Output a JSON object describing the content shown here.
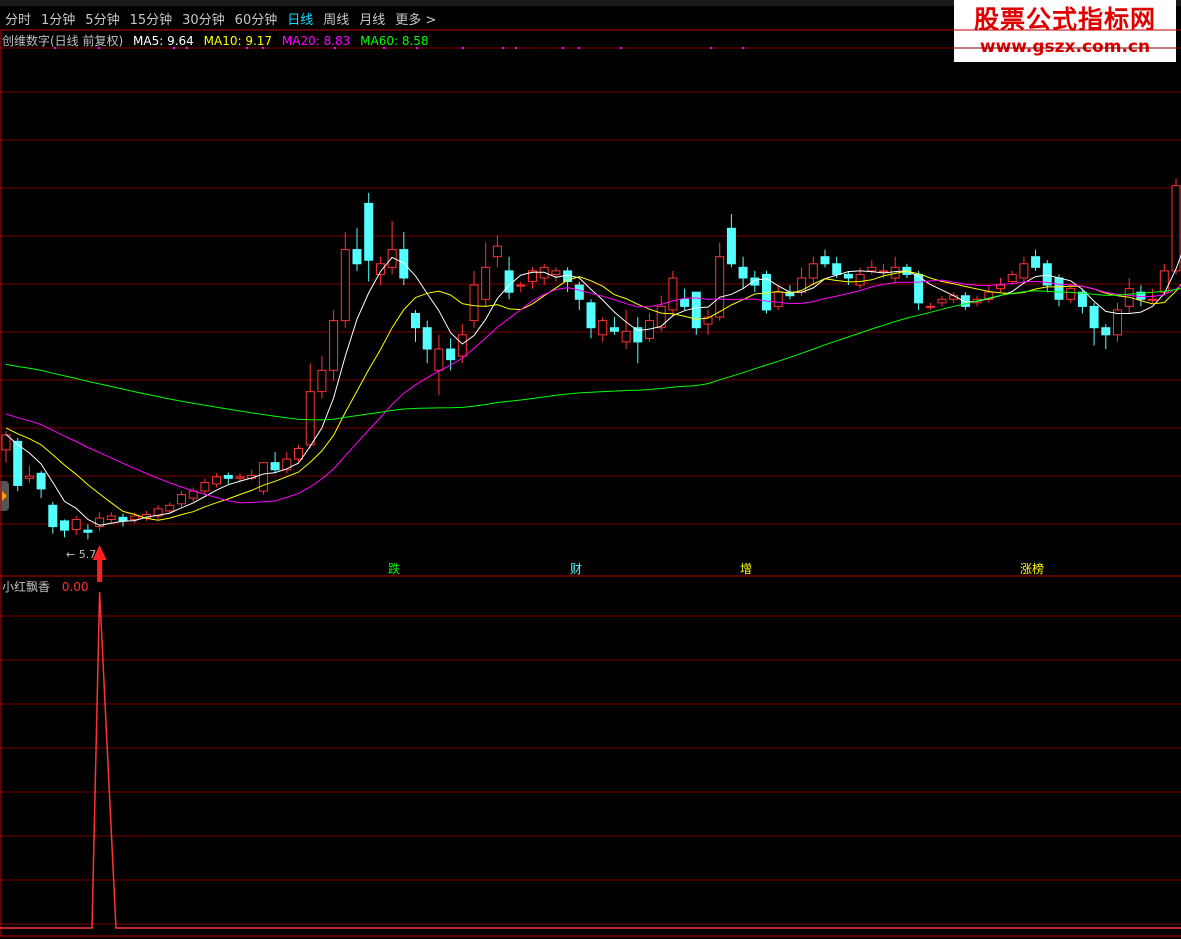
{
  "periods": [
    "分时",
    "1分钟",
    "5分钟",
    "15分钟",
    "30分钟",
    "60分钟",
    "日线",
    "周线",
    "月线"
  ],
  "active_period": "日线",
  "more_label": "更多 >",
  "legend": {
    "name": "创维数字(日线 前复权)",
    "ma5": "MA5: 9.64",
    "ma10": "MA10: 9.17",
    "ma20": "MA20: 8.83",
    "ma60": "MA60: 8.58"
  },
  "colors": {
    "up": "#ff3232",
    "down": "#54ffff",
    "ma5": "#ffffff",
    "ma10": "#ffff00",
    "ma20": "#ff00ff",
    "ma60": "#00ff00",
    "grid": "#7a0000",
    "indicator": "#ff3232"
  },
  "watermark": {
    "line1": "股票公式指标网",
    "line2": "www.gszx.com.cn"
  },
  "low_marker": "5.7",
  "news_tags": [
    {
      "label": "跌",
      "color": "#00ff00"
    },
    {
      "label": "财",
      "color": "#54ffff"
    },
    {
      "label": "增",
      "color": "#ffff00"
    },
    {
      "label": "涨榜",
      "color": "#ffff00"
    }
  ],
  "indicator": {
    "name": "小红飘香",
    "value": "0.00"
  },
  "chart_data": {
    "type": "candlestick",
    "ma_series": [
      "MA5",
      "MA10",
      "MA20",
      "MA60"
    ],
    "signal_count": 1,
    "candles": [
      [
        6.98,
        7.19,
        7.24,
        6.8
      ],
      [
        7.1,
        6.48,
        7.15,
        6.4
      ],
      [
        6.58,
        6.61,
        6.76,
        6.52
      ],
      [
        6.65,
        6.43,
        6.68,
        6.3
      ],
      [
        6.2,
        5.9,
        6.25,
        5.8
      ],
      [
        5.98,
        5.85,
        6.0,
        5.75
      ],
      [
        5.86,
        6.0,
        6.05,
        5.78
      ],
      [
        5.85,
        5.82,
        5.93,
        5.72
      ],
      [
        5.9,
        6.02,
        6.1,
        5.84
      ],
      [
        6.0,
        6.05,
        6.1,
        5.95
      ],
      [
        6.03,
        5.98,
        6.08,
        5.9
      ],
      [
        6.0,
        6.05,
        6.1,
        5.95
      ],
      [
        6.02,
        6.07,
        6.12,
        5.98
      ],
      [
        6.05,
        6.15,
        6.2,
        6.0
      ],
      [
        6.12,
        6.2,
        6.24,
        6.08
      ],
      [
        6.22,
        6.35,
        6.4,
        6.18
      ],
      [
        6.3,
        6.4,
        6.45,
        6.25
      ],
      [
        6.4,
        6.52,
        6.58,
        6.35
      ],
      [
        6.5,
        6.6,
        6.65,
        6.45
      ],
      [
        6.62,
        6.58,
        6.66,
        6.5
      ],
      [
        6.58,
        6.6,
        6.65,
        6.52
      ],
      [
        6.58,
        6.62,
        6.7,
        6.55
      ],
      [
        6.4,
        6.8,
        6.8,
        6.35
      ],
      [
        6.8,
        6.7,
        6.95,
        6.65
      ],
      [
        6.7,
        6.85,
        6.95,
        6.65
      ],
      [
        6.85,
        7.0,
        7.05,
        6.8
      ],
      [
        7.05,
        7.8,
        8.2,
        7.0
      ],
      [
        7.8,
        8.1,
        8.3,
        7.7
      ],
      [
        8.1,
        8.8,
        8.95,
        7.95
      ],
      [
        8.8,
        9.8,
        10.05,
        8.7
      ],
      [
        9.8,
        9.6,
        10.1,
        9.5
      ],
      [
        10.45,
        9.65,
        10.6,
        9.35
      ],
      [
        9.45,
        9.6,
        9.7,
        9.3
      ],
      [
        9.55,
        9.8,
        10.2,
        9.45
      ],
      [
        9.8,
        9.4,
        10.05,
        9.3
      ],
      [
        8.9,
        8.7,
        8.95,
        8.5
      ],
      [
        8.7,
        8.4,
        8.8,
        8.2
      ],
      [
        8.1,
        8.4,
        8.6,
        7.75
      ],
      [
        8.4,
        8.25,
        8.55,
        8.1
      ],
      [
        8.3,
        8.6,
        8.75,
        8.2
      ],
      [
        8.8,
        9.3,
        9.5,
        8.7
      ],
      [
        9.1,
        9.55,
        9.9,
        9.0
      ],
      [
        9.7,
        9.85,
        10.0,
        9.55
      ],
      [
        9.5,
        9.2,
        9.7,
        9.1
      ],
      [
        9.3,
        9.3,
        9.35,
        9.2
      ],
      [
        9.35,
        9.5,
        9.55,
        9.25
      ],
      [
        9.4,
        9.55,
        9.6,
        9.3
      ],
      [
        9.45,
        9.5,
        9.55,
        9.35
      ],
      [
        9.5,
        9.35,
        9.55,
        9.2
      ],
      [
        9.3,
        9.1,
        9.35,
        8.95
      ],
      [
        9.05,
        8.7,
        9.1,
        8.55
      ],
      [
        8.6,
        8.8,
        8.85,
        8.5
      ],
      [
        8.7,
        8.65,
        8.85,
        8.6
      ],
      [
        8.5,
        8.65,
        8.95,
        8.4
      ],
      [
        8.7,
        8.5,
        8.85,
        8.2
      ],
      [
        8.55,
        8.8,
        8.9,
        8.5
      ],
      [
        8.7,
        9.0,
        9.15,
        8.65
      ],
      [
        8.95,
        9.4,
        9.5,
        8.85
      ],
      [
        9.1,
        9.0,
        9.25,
        8.95
      ],
      [
        9.2,
        8.7,
        9.2,
        8.6
      ],
      [
        8.75,
        8.85,
        8.95,
        8.6
      ],
      [
        8.85,
        9.7,
        9.9,
        8.8
      ],
      [
        10.1,
        9.6,
        10.3,
        9.55
      ],
      [
        9.55,
        9.4,
        9.7,
        9.25
      ],
      [
        9.4,
        9.3,
        9.5,
        9.2
      ],
      [
        9.45,
        8.95,
        9.5,
        8.9
      ],
      [
        9.0,
        9.2,
        9.3,
        8.95
      ],
      [
        9.2,
        9.15,
        9.3,
        9.1
      ],
      [
        9.2,
        9.4,
        9.55,
        9.15
      ],
      [
        9.4,
        9.6,
        9.7,
        9.3
      ],
      [
        9.7,
        9.6,
        9.8,
        9.55
      ],
      [
        9.6,
        9.45,
        9.7,
        9.4
      ],
      [
        9.45,
        9.4,
        9.5,
        9.3
      ],
      [
        9.3,
        9.45,
        9.55,
        9.25
      ],
      [
        9.5,
        9.55,
        9.65,
        9.45
      ],
      [
        9.5,
        9.5,
        9.6,
        9.4
      ],
      [
        9.4,
        9.55,
        9.7,
        9.35
      ],
      [
        9.55,
        9.45,
        9.6,
        9.4
      ],
      [
        9.45,
        9.05,
        9.5,
        8.95
      ],
      [
        9.0,
        9.0,
        9.05,
        8.95
      ],
      [
        9.05,
        9.1,
        9.15,
        9.0
      ],
      [
        9.1,
        9.15,
        9.2,
        9.05
      ],
      [
        9.15,
        9.0,
        9.2,
        8.95
      ],
      [
        9.05,
        9.1,
        9.15,
        9.0
      ],
      [
        9.1,
        9.2,
        9.3,
        9.05
      ],
      [
        9.25,
        9.3,
        9.4,
        9.2
      ],
      [
        9.35,
        9.45,
        9.5,
        9.3
      ],
      [
        9.4,
        9.6,
        9.7,
        9.35
      ],
      [
        9.7,
        9.55,
        9.8,
        9.5
      ],
      [
        9.6,
        9.3,
        9.65,
        9.2
      ],
      [
        9.4,
        9.1,
        9.45,
        9.0
      ],
      [
        9.1,
        9.25,
        9.3,
        9.05
      ],
      [
        9.2,
        9.0,
        9.25,
        8.9
      ],
      [
        9.0,
        8.7,
        9.05,
        8.45
      ],
      [
        8.7,
        8.6,
        8.75,
        8.4
      ],
      [
        8.6,
        8.95,
        9.05,
        8.5
      ],
      [
        9.0,
        9.25,
        9.4,
        8.9
      ],
      [
        9.2,
        9.1,
        9.3,
        9.0
      ],
      [
        9.1,
        9.1,
        9.25,
        9.05
      ],
      [
        9.2,
        9.5,
        9.6,
        9.15
      ],
      [
        9.5,
        10.7,
        10.8,
        9.45
      ],
      [
        10.7,
        11.4,
        12.05,
        10.6
      ],
      [
        11.4,
        10.9,
        11.7,
        10.8
      ],
      [
        10.85,
        10.7,
        11.3,
        10.6
      ],
      [
        10.7,
        10.7,
        10.9,
        10.55
      ],
      [
        10.6,
        10.3,
        10.75,
        10.2
      ],
      [
        10.3,
        10.5,
        10.8,
        10.2
      ],
      [
        10.4,
        10.6,
        10.8,
        10.3
      ],
      [
        10.5,
        10.8,
        11.0,
        10.4
      ],
      [
        10.7,
        10.6,
        10.9,
        10.45
      ],
      [
        10.6,
        10.8,
        10.95,
        10.5
      ],
      [
        10.9,
        10.7,
        11.0,
        10.6
      ],
      [
        10.7,
        10.4,
        10.8,
        10.3
      ],
      [
        10.4,
        10.1,
        10.55,
        10.0
      ],
      [
        10.15,
        10.35,
        10.45,
        10.05
      ]
    ]
  }
}
